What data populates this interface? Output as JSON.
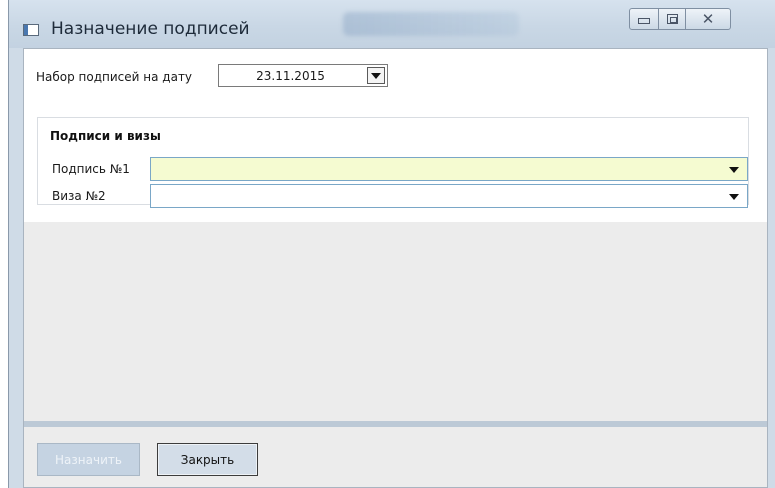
{
  "window": {
    "title": "Назначение подписей",
    "icon": "window-app-icon",
    "controls": [
      "minimize-icon",
      "maximize-icon",
      "close-icon"
    ],
    "close_glyph": "✕"
  },
  "date_set": {
    "label": "Набор подписей на дату",
    "value": "23.11.2015"
  },
  "signatures": {
    "group_title": "Подписи и визы",
    "fields": [
      {
        "label": "Подпись №1",
        "value": "",
        "highlight": "#f5fbd1"
      },
      {
        "label": "Виза №2",
        "value": ""
      }
    ]
  },
  "footer": {
    "assign_label": "Назначить",
    "assign_enabled": false,
    "close_label": "Закрыть"
  }
}
